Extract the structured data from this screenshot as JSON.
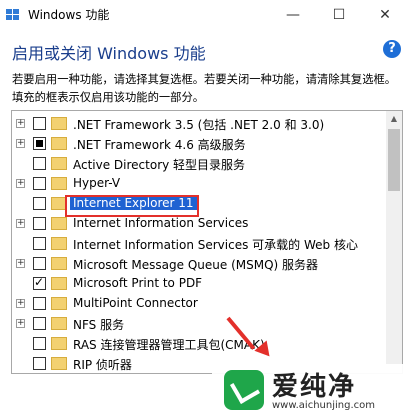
{
  "window": {
    "title": "Windows 功能",
    "minimize": "—",
    "maximize": "☐",
    "close": "✕"
  },
  "header": {
    "heading": "启用或关闭 Windows 功能",
    "help": "?",
    "description": "若要启用一种功能，请选择其复选框。若要关闭一种功能，请清除其复选框。填充的框表示仅启用该功能的一部分。"
  },
  "features": [
    {
      "label": ".NET Framework 3.5 (包括 .NET 2.0 和 3.0)",
      "expandable": true,
      "state": "unchecked"
    },
    {
      "label": ".NET Framework 4.6 高级服务",
      "expandable": true,
      "state": "partial"
    },
    {
      "label": "Active Directory 轻型目录服务",
      "expandable": false,
      "state": "unchecked"
    },
    {
      "label": "Hyper-V",
      "expandable": true,
      "state": "unchecked"
    },
    {
      "label": "Internet Explorer 11",
      "expandable": false,
      "state": "unchecked",
      "selected": true
    },
    {
      "label": "Internet Information Services",
      "expandable": true,
      "state": "unchecked"
    },
    {
      "label": "Internet Information Services 可承载的 Web 核心",
      "expandable": false,
      "state": "unchecked"
    },
    {
      "label": "Microsoft Message Queue (MSMQ) 服务器",
      "expandable": true,
      "state": "unchecked"
    },
    {
      "label": "Microsoft Print to PDF",
      "expandable": false,
      "state": "checked"
    },
    {
      "label": "MultiPoint Connector",
      "expandable": true,
      "state": "unchecked"
    },
    {
      "label": "NFS 服务",
      "expandable": true,
      "state": "unchecked"
    },
    {
      "label": "RAS 连接管理器管理工具包(CMAK)",
      "expandable": false,
      "state": "unchecked"
    },
    {
      "label": "RIP 侦听器",
      "expandable": false,
      "state": "unchecked"
    }
  ],
  "watermark": {
    "brand": "爱纯净",
    "url": "www.aichunjing.com"
  },
  "colors": {
    "heading": "#1a3e8c",
    "selection": "#1f62d2",
    "highlight": "#e3302b"
  }
}
